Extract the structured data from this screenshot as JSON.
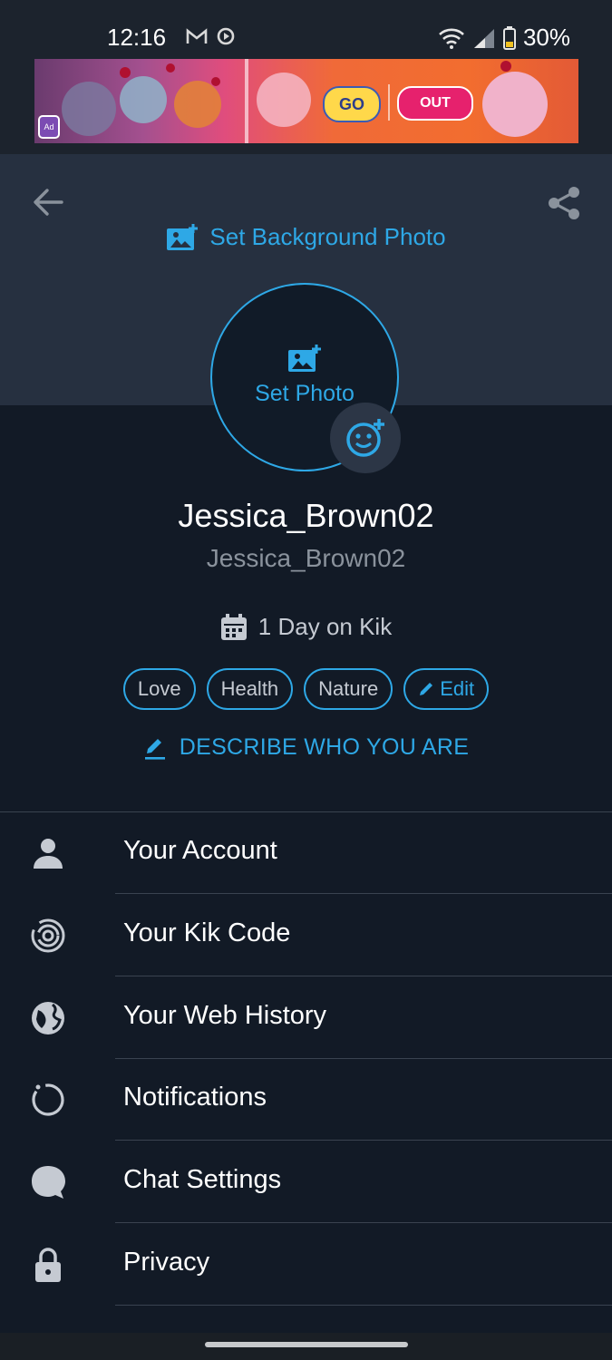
{
  "status_bar": {
    "time": "12:16",
    "battery": "30%",
    "left_icons": [
      "gmail-icon",
      "media-icon"
    ],
    "right_icons": [
      "wifi-icon",
      "signal-icon",
      "battery-icon"
    ]
  },
  "ad": {
    "badge": "Ad",
    "logo_text": "GO",
    "tagline": "OUT"
  },
  "header": {
    "set_background_label": "Set Background Photo",
    "set_photo_label": "Set Photo"
  },
  "profile": {
    "display_name": "Jessica_Brown02",
    "username": "Jessica_Brown02",
    "days_on_kik": "1 Day on Kik",
    "tags": [
      "Love",
      "Health",
      "Nature"
    ],
    "edit_label": "Edit",
    "describe_label": "DESCRIBE WHO YOU ARE"
  },
  "menu": {
    "items": [
      {
        "label": "Your Account",
        "icon": "person-icon"
      },
      {
        "label": "Your Kik Code",
        "icon": "kik-code-icon"
      },
      {
        "label": "Your Web History",
        "icon": "globe-icon"
      },
      {
        "label": "Notifications",
        "icon": "notification-ring-icon"
      },
      {
        "label": "Chat Settings",
        "icon": "chat-bubble-icon"
      },
      {
        "label": "Privacy",
        "icon": "lock-icon"
      }
    ]
  },
  "colors": {
    "accent": "#2ea8e6",
    "background": "#121a26",
    "header_bg": "#263040"
  }
}
